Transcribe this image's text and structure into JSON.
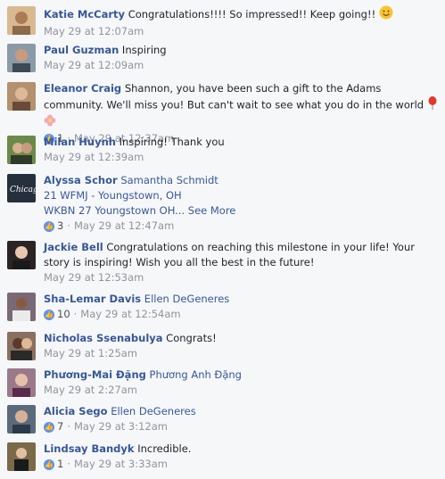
{
  "comments": [
    {
      "author": "Katie McCarty",
      "text": "Congratulations!!!! So impressed!! Keep going!!",
      "emoji": "smile-emoji",
      "time": "May 29 at 12:07am",
      "likes": null,
      "avatar_color": "#c9a37a"
    },
    {
      "author": "Paul Guzman",
      "text": "Inspiring",
      "time": "May 29 at 12:09am",
      "likes": null,
      "avatar_color": "#6b7f8e"
    },
    {
      "author": "Eleanor Craig",
      "text": "Shannon, you have been such a gift to the Adams community. We'll miss you! But can't wait to see what you do in the world",
      "time": "May 29 at 12:37am",
      "likes": "1",
      "avatar_color": "#8b6b52"
    },
    {
      "author": "Milan Huynh",
      "text": "Inspiring! Thank you",
      "time": "May 29 at 12:39am",
      "likes": null,
      "avatar_color": "#4a6a3a"
    },
    {
      "author": "Alyssa Schor",
      "tag": "Samantha Schmidt",
      "line2": "21 WFMJ - Youngstown, OH",
      "line3": "WKBN 27 Youngstown OH...",
      "see_more": "See More",
      "time": "May 29 at 12:47am",
      "likes": "3",
      "avatar_color": "#2d3a4a"
    },
    {
      "author": "Jackie Bell",
      "text": "Congratulations on reaching this milestone in your life! Your story is inspiring! Wish you all the best in the future!",
      "time": "May 29 at 12:53am",
      "likes": null,
      "avatar_color": "#3a3030"
    },
    {
      "author": "Sha-Lemar Davis",
      "tag": "Ellen DeGeneres",
      "time": "May 29 at 12:54am",
      "likes": "10",
      "avatar_color": "#5a4a55"
    },
    {
      "author": "Nicholas Ssenabulya",
      "text": "Congrats!",
      "time": "May 29 at 1:25am",
      "likes": null,
      "avatar_color": "#6a5040"
    },
    {
      "author": "Phương-Mai Đặng",
      "tag": "Phương Anh Đặng",
      "time": "May 29 at 2:27am",
      "likes": null,
      "avatar_color": "#7a5a6a"
    },
    {
      "author": "Alicia Sego",
      "tag": "Ellen DeGeneres",
      "time": "May 29 at 3:12am",
      "likes": "7",
      "avatar_color": "#4a5a6a"
    },
    {
      "author": "Lindsay Bandyk",
      "text": "Incredible.",
      "time": "May 29 at 3:33am",
      "likes": "1",
      "avatar_color": "#6a5a3a"
    }
  ],
  "icons": {
    "like": "thumbs-up-icon",
    "balloon": "balloon-icon",
    "flower": "flower-icon"
  }
}
